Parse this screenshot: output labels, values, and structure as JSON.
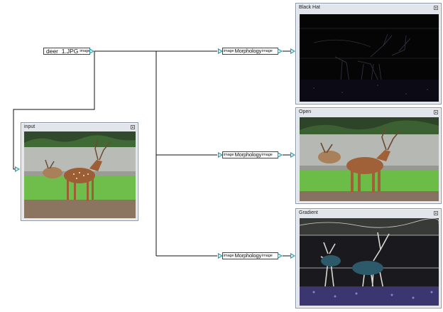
{
  "source_node": {
    "filename": "deer_1.JPG",
    "out_port": "image"
  },
  "morph_nodes": [
    {
      "in_port": "image",
      "title": "Morphology",
      "out_port": "image"
    },
    {
      "in_port": "image",
      "title": "Morphology",
      "out_port": "image"
    },
    {
      "in_port": "image",
      "title": "Morphology",
      "out_port": "image"
    }
  ],
  "viewers": {
    "input": {
      "title": "input"
    },
    "black_hat": {
      "title": "Black Hat"
    },
    "open": {
      "title": "Open"
    },
    "gradient": {
      "title": "Gradient"
    }
  },
  "colors": {
    "wire": "#111111",
    "port_arrow": "#2a9aa8",
    "viewer_frame": "#8c96a2",
    "viewer_bg": "#e2e6ec"
  },
  "icons": {
    "viewer_button": "maximize-icon",
    "port": "triangle-port-icon"
  }
}
